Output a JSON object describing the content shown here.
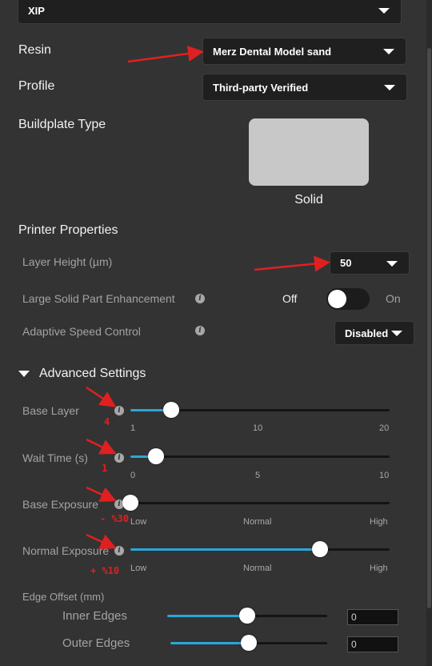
{
  "printer_select": {
    "value": "XIP"
  },
  "resin": {
    "label": "Resin",
    "value": "Merz Dental Model sand"
  },
  "profile": {
    "label": "Profile",
    "value": "Third-party Verified"
  },
  "buildplate": {
    "label": "Buildplate Type",
    "option_label": "Solid"
  },
  "printer_properties": {
    "heading": "Printer Properties",
    "layer_height": {
      "label": "Layer Height (µm)",
      "value": "50"
    },
    "large_solid": {
      "label": "Large Solid Part Enhancement",
      "off_label": "Off",
      "on_label": "On",
      "state": "off"
    },
    "adaptive_speed": {
      "label": "Adaptive Speed Control",
      "value": "Disabled"
    }
  },
  "advanced": {
    "heading": "Advanced Settings",
    "base_layer": {
      "label": "Base Layer",
      "ticks": [
        "1",
        "10",
        "20"
      ],
      "min": 1,
      "max": 20,
      "value": 4,
      "note": "4"
    },
    "wait_time": {
      "label": "Wait Time (s)",
      "ticks": [
        "0",
        "5",
        "10"
      ],
      "min": 0,
      "max": 10,
      "value": 1,
      "note": "1"
    },
    "base_exposure": {
      "label": "Base Exposure",
      "ticks": [
        "Low",
        "Normal",
        "High"
      ],
      "level": 0.0,
      "note": "- %30"
    },
    "normal_exposure": {
      "label": "Normal Exposure",
      "ticks": [
        "Low",
        "Normal",
        "High"
      ],
      "level": 0.73,
      "note": "+ %10"
    },
    "edge_offset": {
      "label": "Edge Offset (mm)",
      "inner": {
        "label": "Inner Edges",
        "level": 0.5,
        "value": "0"
      },
      "outer": {
        "label": "Outer Edges",
        "level": 0.5,
        "value": "0"
      }
    }
  },
  "colors": {
    "background": "#333333",
    "accent": "#2aa6dc",
    "annotation": "#e02020"
  },
  "icons": {
    "info": "info-icon",
    "dropdown": "chevron-down-icon",
    "expand": "triangle-down-icon"
  }
}
